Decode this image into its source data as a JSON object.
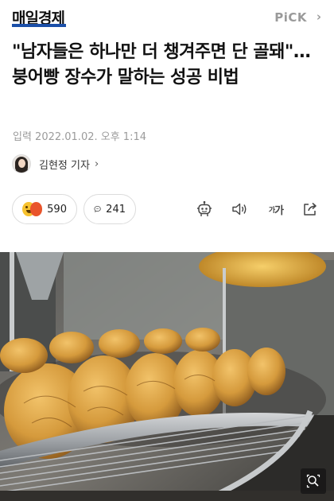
{
  "header": {
    "logo": "매일경제",
    "pick_label": "PiCK",
    "pick_chevron": "›"
  },
  "article": {
    "headline": "\"남자들은 하나만 더 챙겨주면 단 골돼\"…붕어빵 장수가 말하는 성공 비법",
    "dateline": "입력 2022.01.02. 오후 1:14",
    "reporter": "김현정 기자",
    "reporter_chevron": "›"
  },
  "actions": {
    "reaction_count": "590",
    "comment_count": "241",
    "icons": [
      "robot-summary-icon",
      "speaker-icon",
      "font-size-icon",
      "share-icon"
    ],
    "font_label_small": "가",
    "font_label_large": "가"
  },
  "colors": {
    "logo_underline": "#1b4fa8",
    "pick": "#9a9a9a",
    "dateline": "#9b9b9b"
  }
}
